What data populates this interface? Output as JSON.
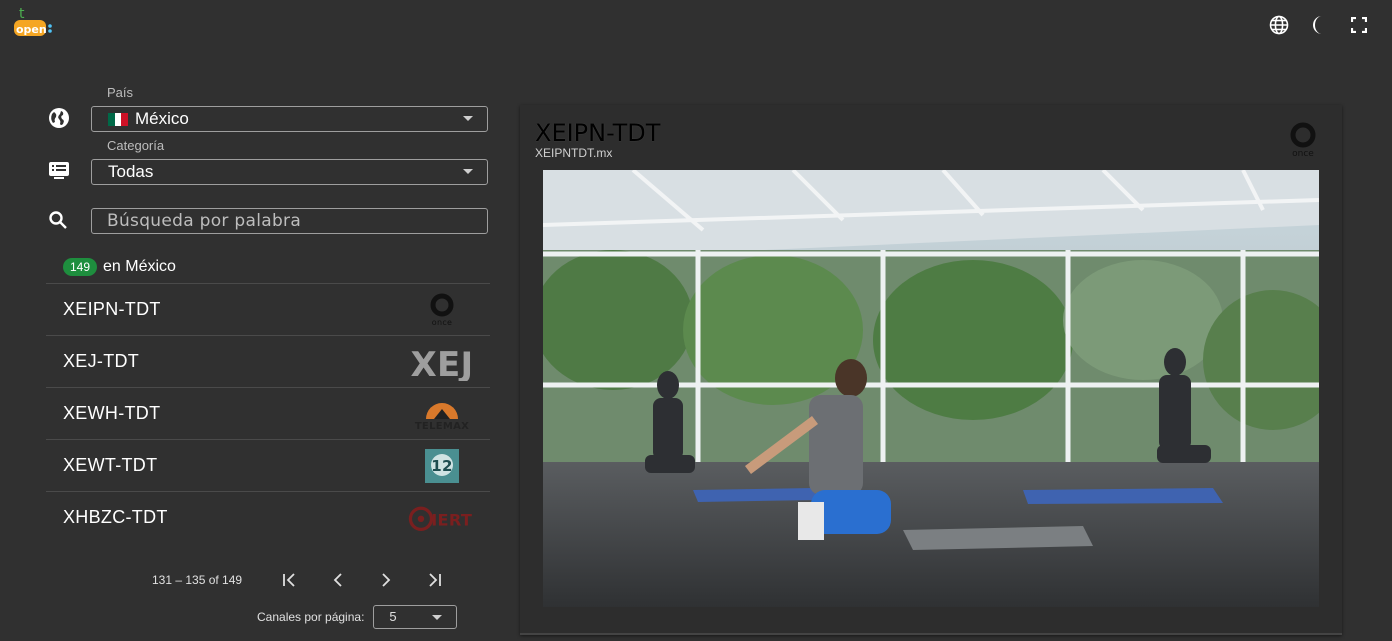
{
  "app": {
    "logo_top": "t",
    "logo_text": "open"
  },
  "header_icons": [
    "language-icon",
    "dark-mode-icon",
    "fullscreen-icon"
  ],
  "filters": {
    "country_label": "País",
    "country_value": "México",
    "category_label": "Categoría",
    "category_value": "Todas",
    "search_placeholder": "Búsqueda por palabra"
  },
  "results": {
    "count": "149",
    "suffix": "en México"
  },
  "channels": [
    {
      "name": "XEIPN-TDT",
      "logo": "once"
    },
    {
      "name": "XEJ-TDT",
      "logo": "XEJ"
    },
    {
      "name": "XEWH-TDT",
      "logo": "TELEMAX"
    },
    {
      "name": "XEWT-TDT",
      "logo": "12"
    },
    {
      "name": "XHBZC-TDT",
      "logo": "IERT"
    }
  ],
  "paginator": {
    "range": "131 – 135 of 149",
    "per_page_label": "Canales por página:",
    "per_page_value": "5"
  },
  "player": {
    "title": "XEIPN-TDT",
    "subtitle": "XEIPNTDT.mx",
    "logo": "once"
  },
  "colors": {
    "background": "#303030",
    "badge": "#1e8e3e"
  }
}
